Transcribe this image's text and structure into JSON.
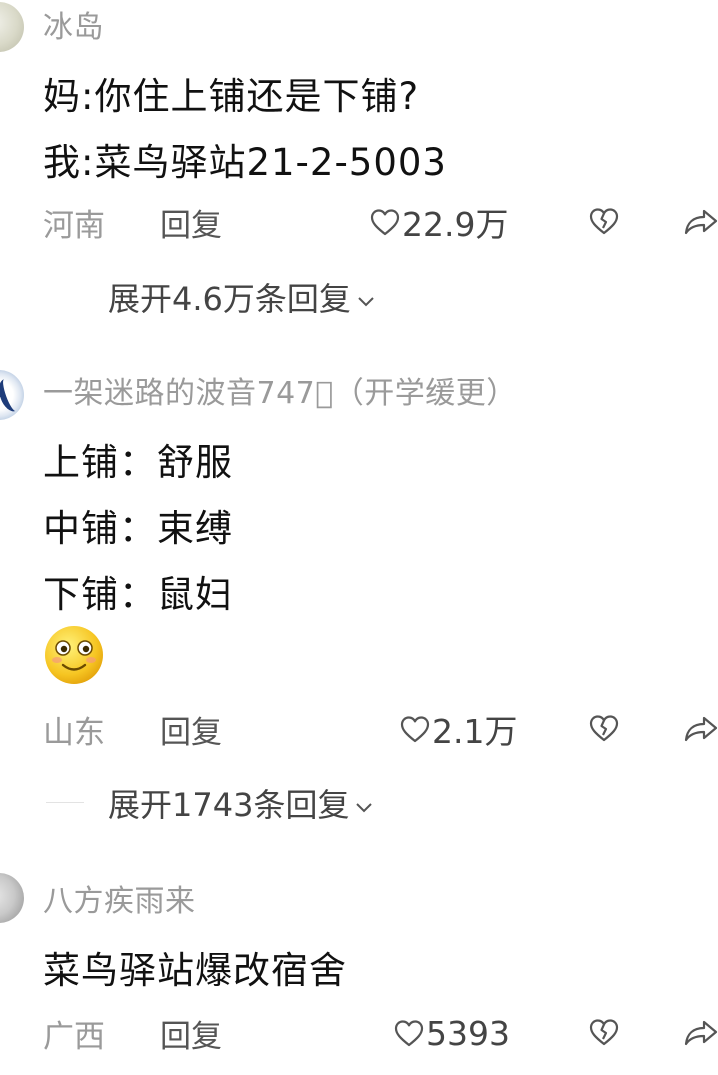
{
  "comments": [
    {
      "username": "冰岛",
      "lines": [
        "妈:你住上铺还是下铺?",
        "我:菜鸟驿站21-2-5003"
      ],
      "location": "河南",
      "reply_label": "回复",
      "likes": "22.9万",
      "expand_label": "展开4.6万条回复"
    },
    {
      "username": "一架迷路的波音747􀀀（开学缓更）",
      "lines": [
        "上铺：舒服",
        "中铺：束缚",
        "下铺：鼠妇"
      ],
      "emoji": "smiling-face-emoji",
      "location": "山东",
      "reply_label": "回复",
      "likes": "2.1万",
      "expand_label": "展开1743条回复"
    },
    {
      "username": "八方疾雨来",
      "lines": [
        "菜鸟驿站爆改宿舍"
      ],
      "location": "广西",
      "reply_label": "回复",
      "likes": "5393"
    }
  ],
  "icons": {
    "like": "heart-outline-icon",
    "dislike": "broken-heart-icon",
    "share": "share-arrow-icon",
    "expand": "chevron-down-icon"
  },
  "colors": {
    "text_primary": "#111111",
    "text_secondary": "#9a9a9a",
    "icon": "#555555"
  }
}
